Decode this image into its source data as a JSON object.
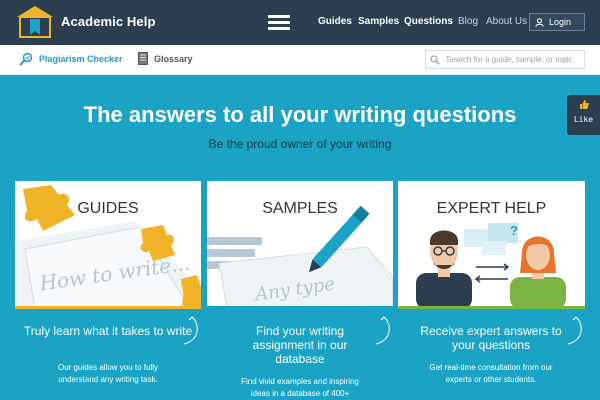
{
  "header": {
    "brand": "Academic Help",
    "nav": [
      "Guides",
      "Samples",
      "Questions",
      "Blog",
      "About Us"
    ],
    "login_label": "Login"
  },
  "subnav": {
    "plagiarism": "Plagiarism Checker",
    "glossary": "Glossary",
    "search_placeholder": "Search for a guide, sample, or topic"
  },
  "hero": {
    "title": "The answers to all your writing questions",
    "subtitle": "Be the proud owner of your writing"
  },
  "like": {
    "label": "Like"
  },
  "cards": [
    {
      "title": "GUIDES",
      "image_text": "How to write...",
      "heading": "Truly learn what it takes to write",
      "description": "Our guides allow you to fully understand any writing task."
    },
    {
      "title": "SAMPLES",
      "image_text": "Any type",
      "heading": "Find your writing assignment in our database",
      "description": "Find vivid examples and inspiring ideas in a database of  400+"
    },
    {
      "title": "EXPERT HELP",
      "image_text": "?",
      "heading": "Receive expert answers to your questions",
      "description": "Get real-time consultation from our experts or other students."
    }
  ],
  "colors": {
    "hero_bg": "#1aa3c4",
    "nav_bg": "#2c3e50",
    "guides_accent": "#f0b429",
    "samples_accent": "#1aa3c4",
    "expert_accent": "#7cb342"
  }
}
